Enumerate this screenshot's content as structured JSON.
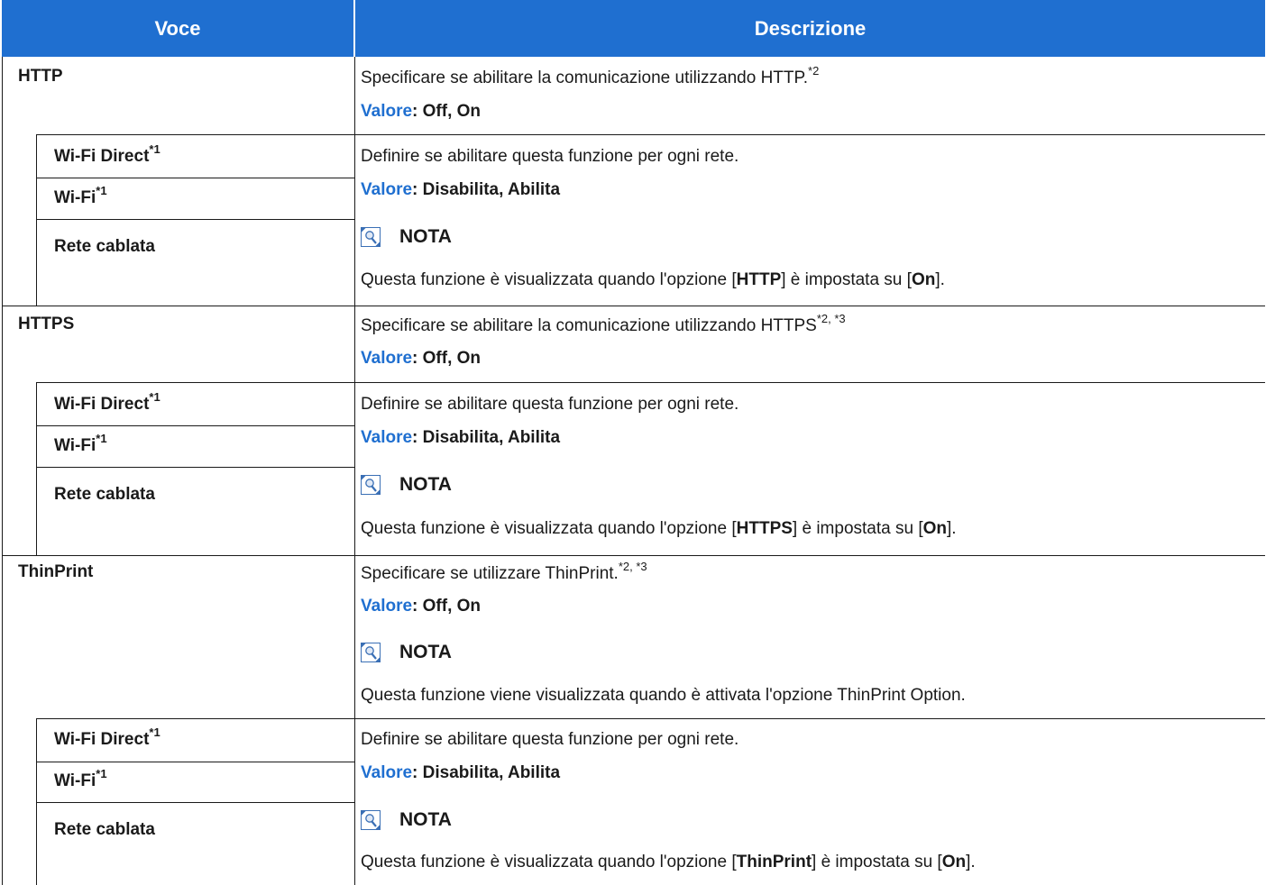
{
  "header": {
    "col1": "Voce",
    "col2": "Descrizione"
  },
  "common": {
    "valore": "Valore",
    "nota": "NOTA",
    "wifi_direct": "Wi-Fi Direct",
    "wifi": "Wi-Fi",
    "wired": "Rete cablata",
    "sup1": "*1",
    "per_network": "Definire se abilitare questa funzione per ogni rete.",
    "onoff_values": ": Off, On",
    "enable_values": ": Disabilita, Abilita"
  },
  "http": {
    "title": "HTTP",
    "desc": "Specificare se abilitare la comunicazione utilizzando HTTP.",
    "desc_sup": "*2",
    "note_pre": "Questa funzione è visualizzata quando l'opzione [",
    "note_key": "HTTP",
    "note_mid": "] è impostata su [",
    "note_val": "On",
    "note_end": "]."
  },
  "https": {
    "title": "HTTPS",
    "desc": "Specificare se abilitare la comunicazione utilizzando HTTPS",
    "desc_sup": "*2, *3",
    "note_pre": "Questa funzione è visualizzata quando l'opzione [",
    "note_key": "HTTPS",
    "note_mid": "] è impostata su [",
    "note_val": "On",
    "note_end": "]."
  },
  "thinprint": {
    "title": "ThinPrint",
    "desc": "Specificare se utilizzare ThinPrint.",
    "desc_sup": "*2, *3",
    "note_main": "Questa funzione viene visualizzata quando è attivata l'opzione ThinPrint Option.",
    "note_pre": "Questa funzione è visualizzata quando l'opzione [",
    "note_key": "ThinPrint",
    "note_mid": "] è impostata su [",
    "note_val": "On",
    "note_end": "]."
  },
  "colors": {
    "header_bg": "#1f6fd0",
    "accent": "#1f6fd0"
  },
  "icons": {
    "note": "note-lightbulb-icon"
  }
}
